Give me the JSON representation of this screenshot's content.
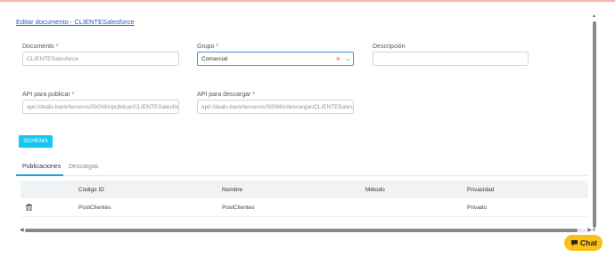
{
  "title": "Editar documento - CLIENTESalesforce",
  "form": {
    "documento_label": "Documento",
    "documento_value": "CLIENTESalesforce",
    "grupo_label": "Grupo",
    "grupo_value": "Comercial",
    "descripcion_label": "Descripción",
    "descripcion_value": "",
    "api_publicar_label": "API para publicar",
    "api_publicar_value": "api/:/deals-back/terceros/SIGMA/publicar/CLIENTESalesforce",
    "api_descargar_label": "API para descargar",
    "api_descargar_value": "api/:/deals-back/terceros/SIGMA/descargar/CLIENTESalesforce",
    "required_mark": "*"
  },
  "schema_button": "SCHEMA",
  "tabs": [
    {
      "label": "Publicaciones",
      "active": true
    },
    {
      "label": "Descargas",
      "active": false
    }
  ],
  "table": {
    "headers": [
      "Código ID",
      "Nombre",
      "Método",
      "Privacidad"
    ],
    "rows": [
      {
        "codigo": "PostClientes",
        "nombre": "PostClientes",
        "metodo": "",
        "privacidad": "Privado"
      }
    ]
  },
  "chat_button": "Chat",
  "colors": {
    "accent": "#13c8ee",
    "link": "#1f5fbf",
    "chat": "#f8c21b"
  }
}
